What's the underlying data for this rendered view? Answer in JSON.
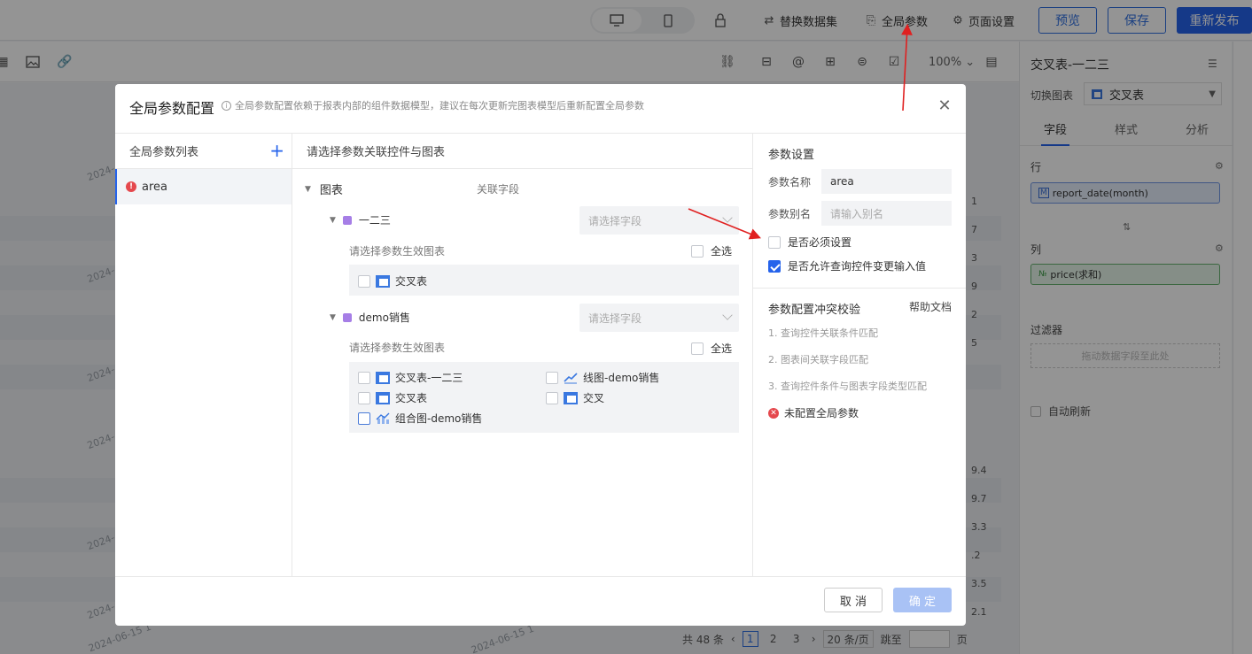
{
  "topbar": {
    "actions": {
      "replace_dataset": "替换数据集",
      "global_params": "全局参数",
      "page_settings": "页面设置"
    },
    "buttons": {
      "preview": "预览",
      "save": "保存",
      "republish": "重新发布"
    }
  },
  "toolbar": {
    "zoom": "100%"
  },
  "background": {
    "dates": [
      "2024-",
      "2024-",
      "2024-",
      "2024-",
      "2024-",
      "2024-",
      "2024-06-15 1",
      "2024-06-15 1"
    ],
    "numbers": [
      "1",
      "7",
      "3",
      "9",
      "2",
      "5",
      "9.4",
      "9.7",
      "3.3",
      ".2",
      "3.5",
      "2.1"
    ]
  },
  "pager": {
    "total": "共 48 条",
    "pages": [
      "1",
      "2",
      "3"
    ],
    "page_size": "20 条/页",
    "jump_label": "跳至",
    "page_unit": "页"
  },
  "right_panel": {
    "title": "交叉表-一二三",
    "switch_label": "切换图表",
    "chart_type": "交叉表",
    "tabs": [
      "字段",
      "样式",
      "分析"
    ],
    "row_label": "行",
    "row_field_tag": "M",
    "row_field": "report_date(month)",
    "col_label": "列",
    "col_field_tag": "№",
    "col_field": "price(求和)",
    "filter_label": "过滤器",
    "filter_drop_hint": "拖动数据字段至此处",
    "auto_refresh": "自动刷新"
  },
  "modal": {
    "title": "全局参数配置",
    "hint": "全局参数配置依赖于报表内部的组件数据模型，建议在每次更新完图表模型后重新配置全局参数",
    "left": {
      "header": "全局参数列表",
      "params": [
        {
          "name": "area",
          "status": "error"
        }
      ]
    },
    "middle": {
      "header": "请选择参数关联控件与图表",
      "tree_root": "图表",
      "related_field_label": "关联字段",
      "select_placeholder": "请选择字段",
      "effect_hint": "请选择参数生效图表",
      "select_all": "全选",
      "datasets": [
        {
          "name": "一二三",
          "charts": [
            "交叉表"
          ]
        },
        {
          "name": "demo销售",
          "charts": [
            "交叉表-一二三",
            "线图-demo销售",
            "交叉表",
            "交叉",
            "组合图-demo销售"
          ]
        }
      ]
    },
    "right": {
      "settings_title": "参数设置",
      "name_label": "参数名称",
      "name_value": "area",
      "alias_label": "参数别名",
      "alias_placeholder": "请输入别名",
      "required_label": "是否必须设置",
      "required_checked": false,
      "allow_change_label": "是否允许查询控件变更输入值",
      "allow_change_checked": true,
      "conflict_title": "参数配置冲突校验",
      "help_doc": "帮助文档",
      "rules": [
        "1. 查询控件关联条件匹配",
        "2. 图表间关联字段匹配",
        "3. 查询控件条件与图表字段类型匹配"
      ],
      "error_text": "未配置全局参数"
    },
    "footer": {
      "cancel": "取 消",
      "confirm": "确 定"
    }
  },
  "colors": {
    "primary": "#2563eb",
    "error": "#e5484d",
    "annotation_arrow": "#e02020"
  }
}
